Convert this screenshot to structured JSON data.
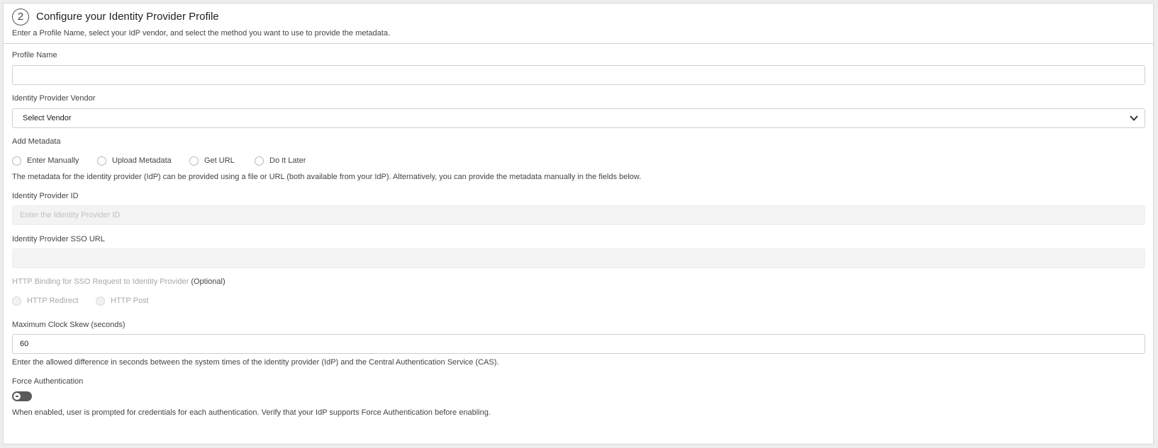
{
  "header": {
    "step_number": "2",
    "title": "Configure your Identity Provider Profile",
    "subtitle": "Enter a Profile Name, select your IdP vendor, and select the method you want to use to provide the metadata."
  },
  "profile_name": {
    "label": "Profile Name",
    "value": "",
    "placeholder": ""
  },
  "vendor": {
    "label": "Identity Provider Vendor",
    "selected": "Select Vendor",
    "icon": "chevron-down-icon"
  },
  "metadata": {
    "label": "Add Metadata",
    "options": [
      "Enter Manually",
      "Upload Metadata",
      "Get URL",
      "Do It Later"
    ],
    "help": "The metadata for the identity provider (IdP) can be provided using a file or URL (both available from your IdP). Alternatively, you can provide the metadata manually in the fields below."
  },
  "idp_id": {
    "label": "Identity Provider ID",
    "placeholder": "Enter the Identity Provider ID"
  },
  "idp_sso_url": {
    "label": "Identity Provider SSO URL",
    "placeholder": ""
  },
  "http_binding": {
    "label": "HTTP Binding for SSO Request to Identity Provider",
    "optional": "(Optional)",
    "options": [
      "HTTP Redirect",
      "HTTP Post"
    ]
  },
  "clock_skew": {
    "label": "Maximum Clock Skew (seconds)",
    "value": "60",
    "help": "Enter the allowed difference in seconds between the system times of the identity provider (IdP) and the Central Authentication Service (CAS)."
  },
  "force_auth": {
    "label": "Force Authentication",
    "enabled": false,
    "help": "When enabled, user is prompted for credentials for each authentication. Verify that your IdP supports Force Authentication before enabling."
  }
}
